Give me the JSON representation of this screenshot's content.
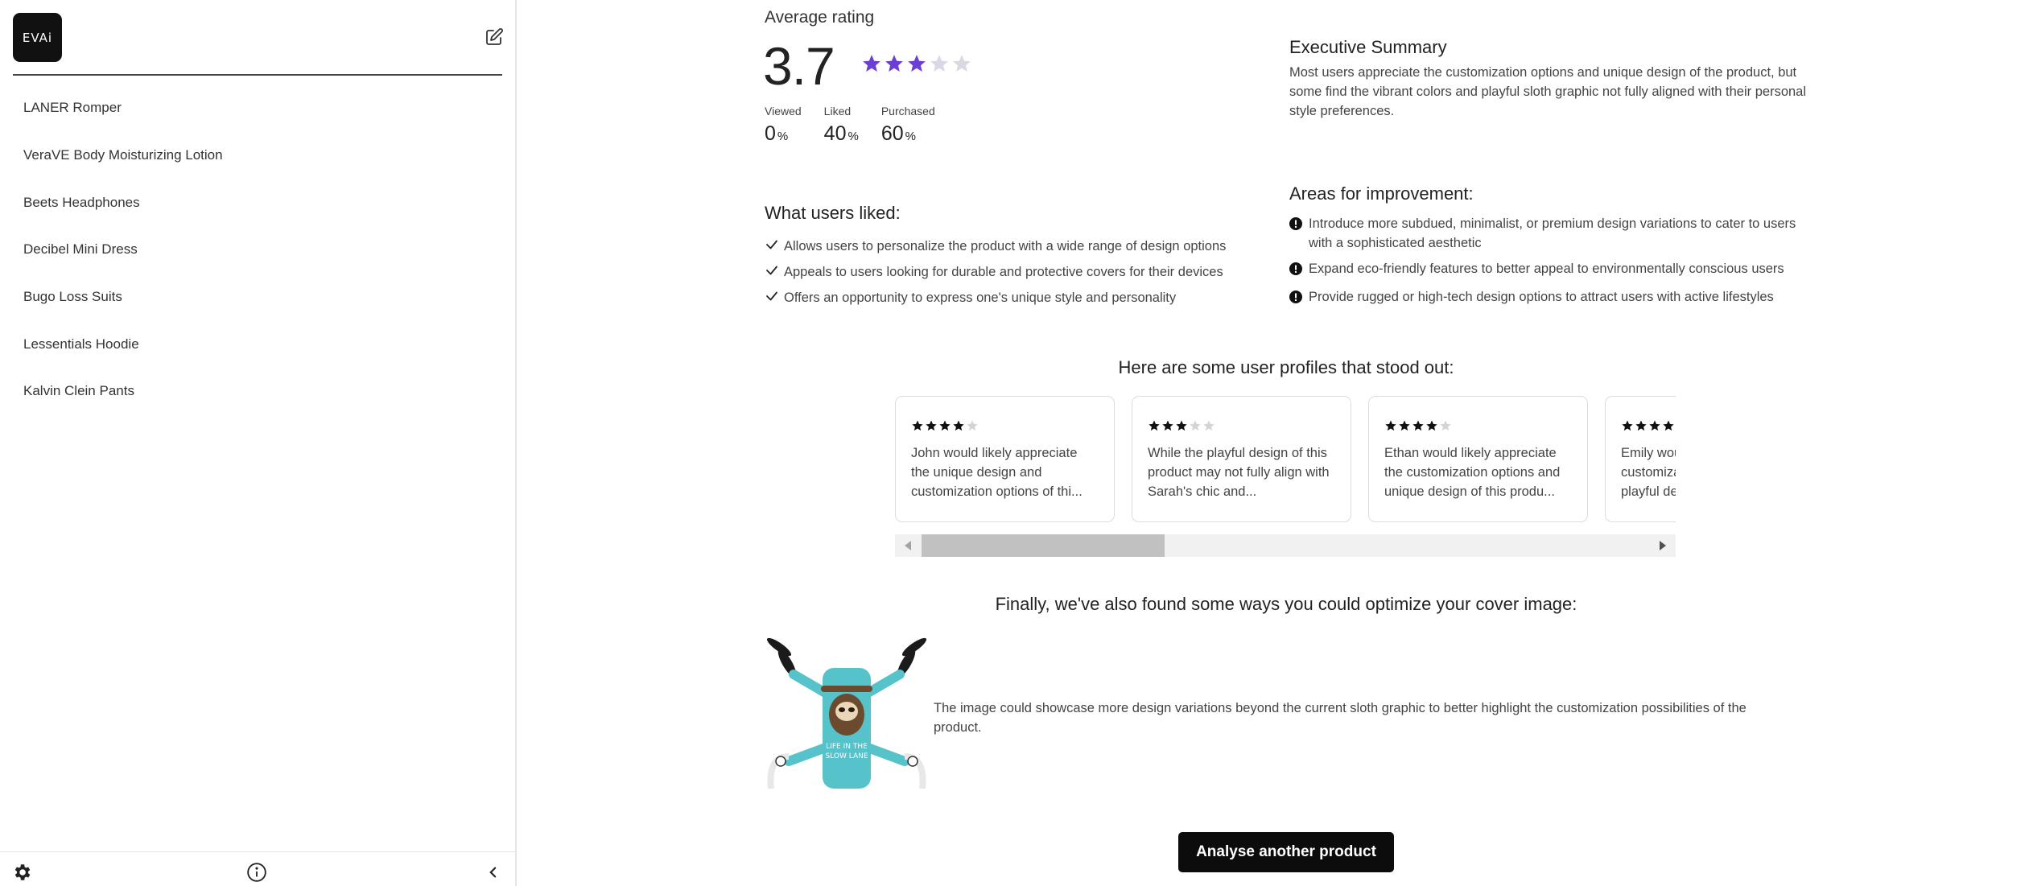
{
  "sidebar": {
    "logo_text": "EVAi",
    "items": [
      {
        "label": "LANER Romper"
      },
      {
        "label": "VeraVE Body Moisturizing Lotion"
      },
      {
        "label": "Beets Headphones"
      },
      {
        "label": "Decibel Mini Dress"
      },
      {
        "label": "Bugo Loss Suits"
      },
      {
        "label": "Lessentials Hoodie"
      },
      {
        "label": "Kalvin Clein Pants"
      }
    ],
    "icons": {
      "new": "edit-icon",
      "settings": "gear-icon",
      "info": "info-icon",
      "collapse": "chevron-left-icon"
    }
  },
  "rating": {
    "label": "Average rating",
    "value": "3.7",
    "stars_filled": 3,
    "stars_total": 5,
    "star_color": "#6b3fd4",
    "stats": [
      {
        "label": "Viewed",
        "value": "0",
        "unit": "%"
      },
      {
        "label": "Liked",
        "value": "40",
        "unit": "%"
      },
      {
        "label": "Purchased",
        "value": "60",
        "unit": "%"
      }
    ]
  },
  "executive_summary": {
    "title": "Executive Summary",
    "text": "Most users appreciate the customization options and unique design of the product, but some find the vibrant colors and playful sloth graphic not fully aligned with their personal style preferences."
  },
  "liked": {
    "title": "What users liked:",
    "items": [
      "Allows users to personalize the product with a wide range of design options",
      "Appeals to users looking for durable and protective covers for their devices",
      "Offers an opportunity to express one's unique style and personality"
    ]
  },
  "improvement": {
    "title": "Areas for improvement:",
    "items": [
      "Introduce more subdued, minimalist, or premium design variations to cater to users with a sophisticated aesthetic",
      "Expand eco-friendly features to better appeal to environmentally conscious users",
      "Provide rugged or high-tech design options to attract users with active lifestyles"
    ]
  },
  "profiles": {
    "title": "Here are some user profiles that stood out:",
    "cards": [
      {
        "stars": 4,
        "text": "John would likely appreciate the unique design and customization options of thi..."
      },
      {
        "stars": 3,
        "text": "While the playful design of this product may not fully align with Sarah's chic and..."
      },
      {
        "stars": 4,
        "text": "Ethan would likely appreciate the customization options and unique design of this produ..."
      },
      {
        "stars": 4,
        "text": "Emily would appreciate the customization options and the playful design..."
      }
    ]
  },
  "optimize": {
    "title": "Finally, we've also found some ways you could optimize your cover image:",
    "image_alt": "drone with sloth skin",
    "text": "The image could showcase more design variations beyond the current sloth graphic to better highlight the customization possibilities of the product."
  },
  "actions": {
    "analyse_label": "Analyse another product"
  }
}
